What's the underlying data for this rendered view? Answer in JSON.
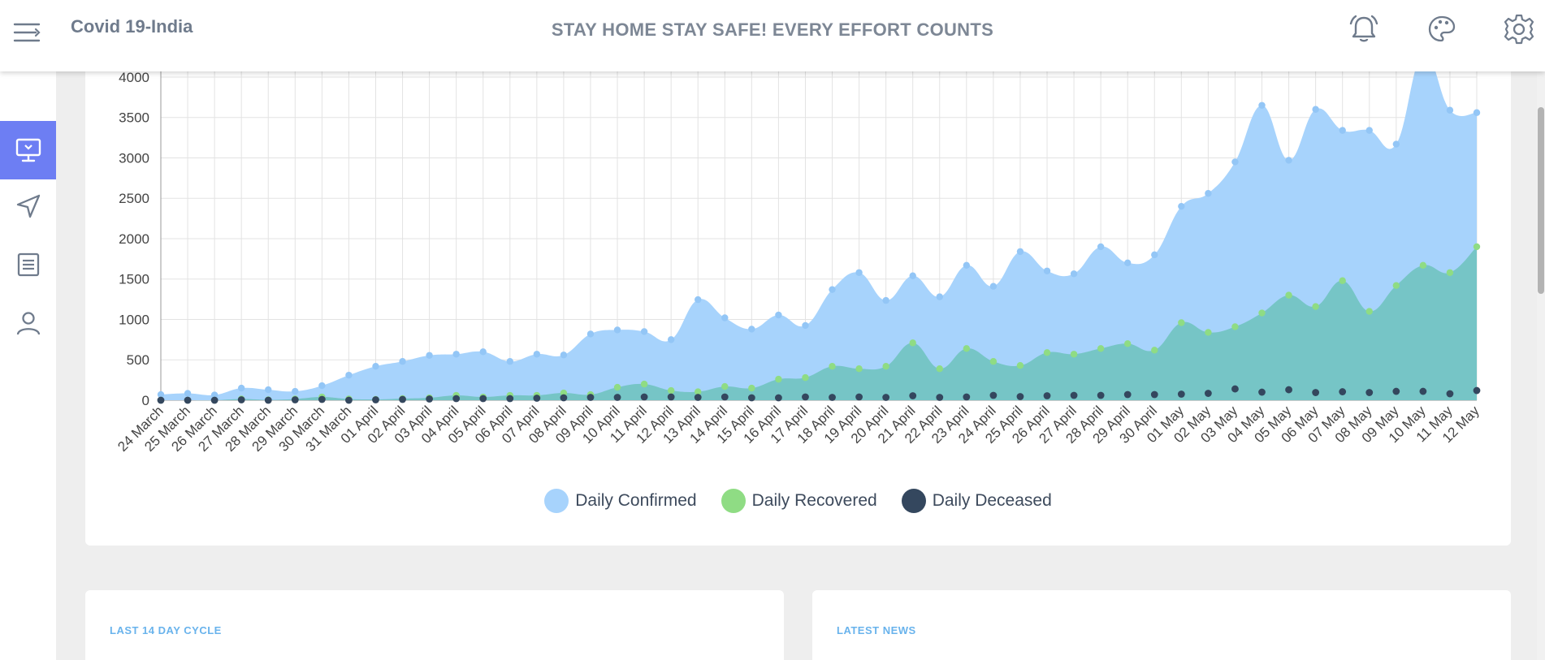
{
  "header": {
    "app_title": "Covid 19-India",
    "banner": "STAY HOME STAY SAFE! EVERY EFFORT COUNTS",
    "icons": [
      "menu-icon",
      "alarm-bell-icon",
      "palette-icon",
      "gear-icon"
    ]
  },
  "sidebar": {
    "items": [
      {
        "name": "dashboard",
        "icon": "monitor-icon",
        "active": true
      },
      {
        "name": "send",
        "icon": "navigation-arrow-icon",
        "active": false
      },
      {
        "name": "news",
        "icon": "document-list-icon",
        "active": false
      },
      {
        "name": "profile",
        "icon": "user-icon",
        "active": false
      }
    ]
  },
  "colors": {
    "confirmed": "#a7d3fc",
    "recovered": "#76c5c6",
    "recovered_point": "#8fdc84",
    "deceased": "#34475e",
    "accent": "#6d7ef3"
  },
  "chart_data": {
    "type": "area",
    "categories": [
      "24 March",
      "25 March",
      "26 March",
      "27 March",
      "28 March",
      "29 March",
      "30 March",
      "31 March",
      "01 April",
      "02 April",
      "03 April",
      "04 April",
      "05 April",
      "06 April",
      "07 April",
      "08 April",
      "09 April",
      "10 April",
      "11 April",
      "12 April",
      "13 April",
      "14 April",
      "15 April",
      "16 April",
      "17 April",
      "18 April",
      "19 April",
      "20 April",
      "21 April",
      "22 April",
      "23 April",
      "24 April",
      "25 April",
      "26 April",
      "27 April",
      "28 April",
      "29 April",
      "30 April",
      "01 May",
      "02 May",
      "03 May",
      "04 May",
      "05 May",
      "06 May",
      "07 May",
      "08 May",
      "09 May",
      "10 May",
      "11 May",
      "12 May"
    ],
    "series": [
      {
        "name": "Daily Confirmed",
        "values": [
          70,
          85,
          65,
          150,
          130,
          110,
          180,
          310,
          420,
          480,
          555,
          570,
          600,
          480,
          570,
          560,
          820,
          870,
          850,
          750,
          1245,
          1020,
          880,
          1055,
          925,
          1370,
          1580,
          1235,
          1540,
          1280,
          1670,
          1410,
          1840,
          1600,
          1565,
          1900,
          1700,
          1800,
          2400,
          2560,
          2950,
          3650,
          2970,
          3600,
          3340,
          3340,
          3170,
          4300,
          3590,
          3560
        ]
      },
      {
        "name": "Daily Recovered",
        "values": [
          0,
          0,
          0,
          15,
          5,
          15,
          40,
          15,
          10,
          20,
          30,
          60,
          40,
          60,
          60,
          90,
          70,
          160,
          200,
          120,
          105,
          170,
          150,
          260,
          280,
          420,
          390,
          420,
          710,
          390,
          640,
          480,
          430,
          590,
          570,
          640,
          700,
          620,
          960,
          840,
          910,
          1080,
          1300,
          1160,
          1480,
          1100,
          1420,
          1670,
          1580,
          1900
        ]
      },
      {
        "name": "Daily Deceased",
        "values": [
          0,
          0,
          0,
          5,
          0,
          5,
          10,
          0,
          5,
          10,
          15,
          20,
          20,
          20,
          25,
          30,
          35,
          35,
          40,
          40,
          35,
          40,
          30,
          30,
          40,
          35,
          40,
          35,
          55,
          35,
          40,
          60,
          45,
          55,
          60,
          60,
          70,
          70,
          75,
          85,
          140,
          100,
          130,
          95,
          105,
          95,
          110,
          110,
          80,
          120
        ]
      }
    ],
    "ylim": [
      0,
      4100
    ],
    "yticks": [
      0,
      500,
      1000,
      1500,
      2000,
      2500,
      3000,
      3500,
      4000
    ],
    "grid": true,
    "legend_position": "bottom-center"
  },
  "cards": {
    "last_14_title": "LAST 14 DAY CYCLE",
    "news_title": "LATEST NEWS"
  }
}
